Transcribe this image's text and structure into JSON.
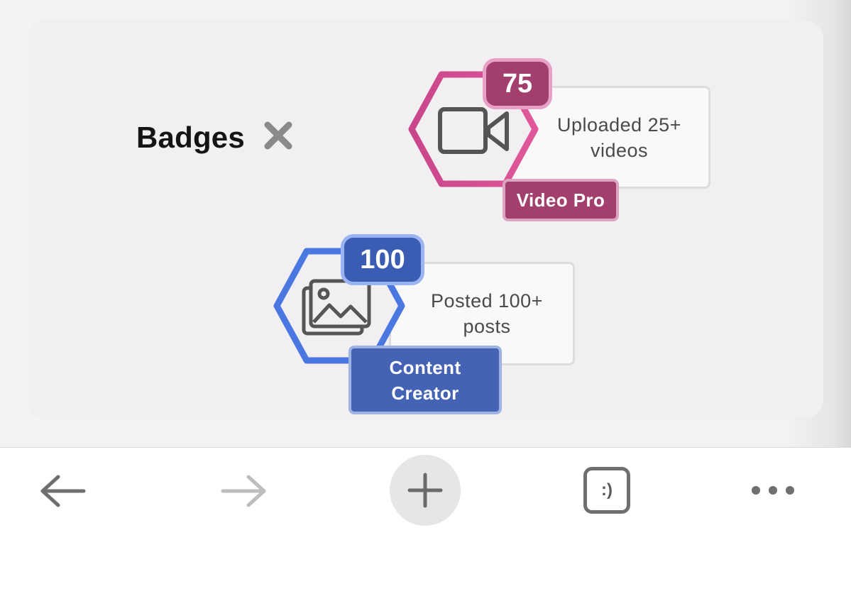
{
  "section": {
    "title": "Badges",
    "close_icon": "close-x-icon"
  },
  "badges": [
    {
      "count": "75",
      "name": "Video Pro",
      "description_line1": "Uploaded 25+",
      "description_line2": "videos",
      "icon": "video-camera-icon",
      "color": "#d04d8c",
      "badge_color": "#a23f6c"
    },
    {
      "count": "100",
      "name_line1": "Content",
      "name_line2": "Creator",
      "description_line1": "Posted 100+",
      "description_line2": "posts",
      "icon": "image-gallery-icon",
      "color": "#4a78e0",
      "badge_color": "#3a5db3"
    }
  ],
  "toolbar": {
    "back_icon": "arrow-left-icon",
    "forward_icon": "arrow-right-icon",
    "new_tab_icon": "plus-icon",
    "tabs_icon": "tab-switcher-icon",
    "tabs_label": ":)",
    "menu_icon": "more-horizontal-icon"
  }
}
